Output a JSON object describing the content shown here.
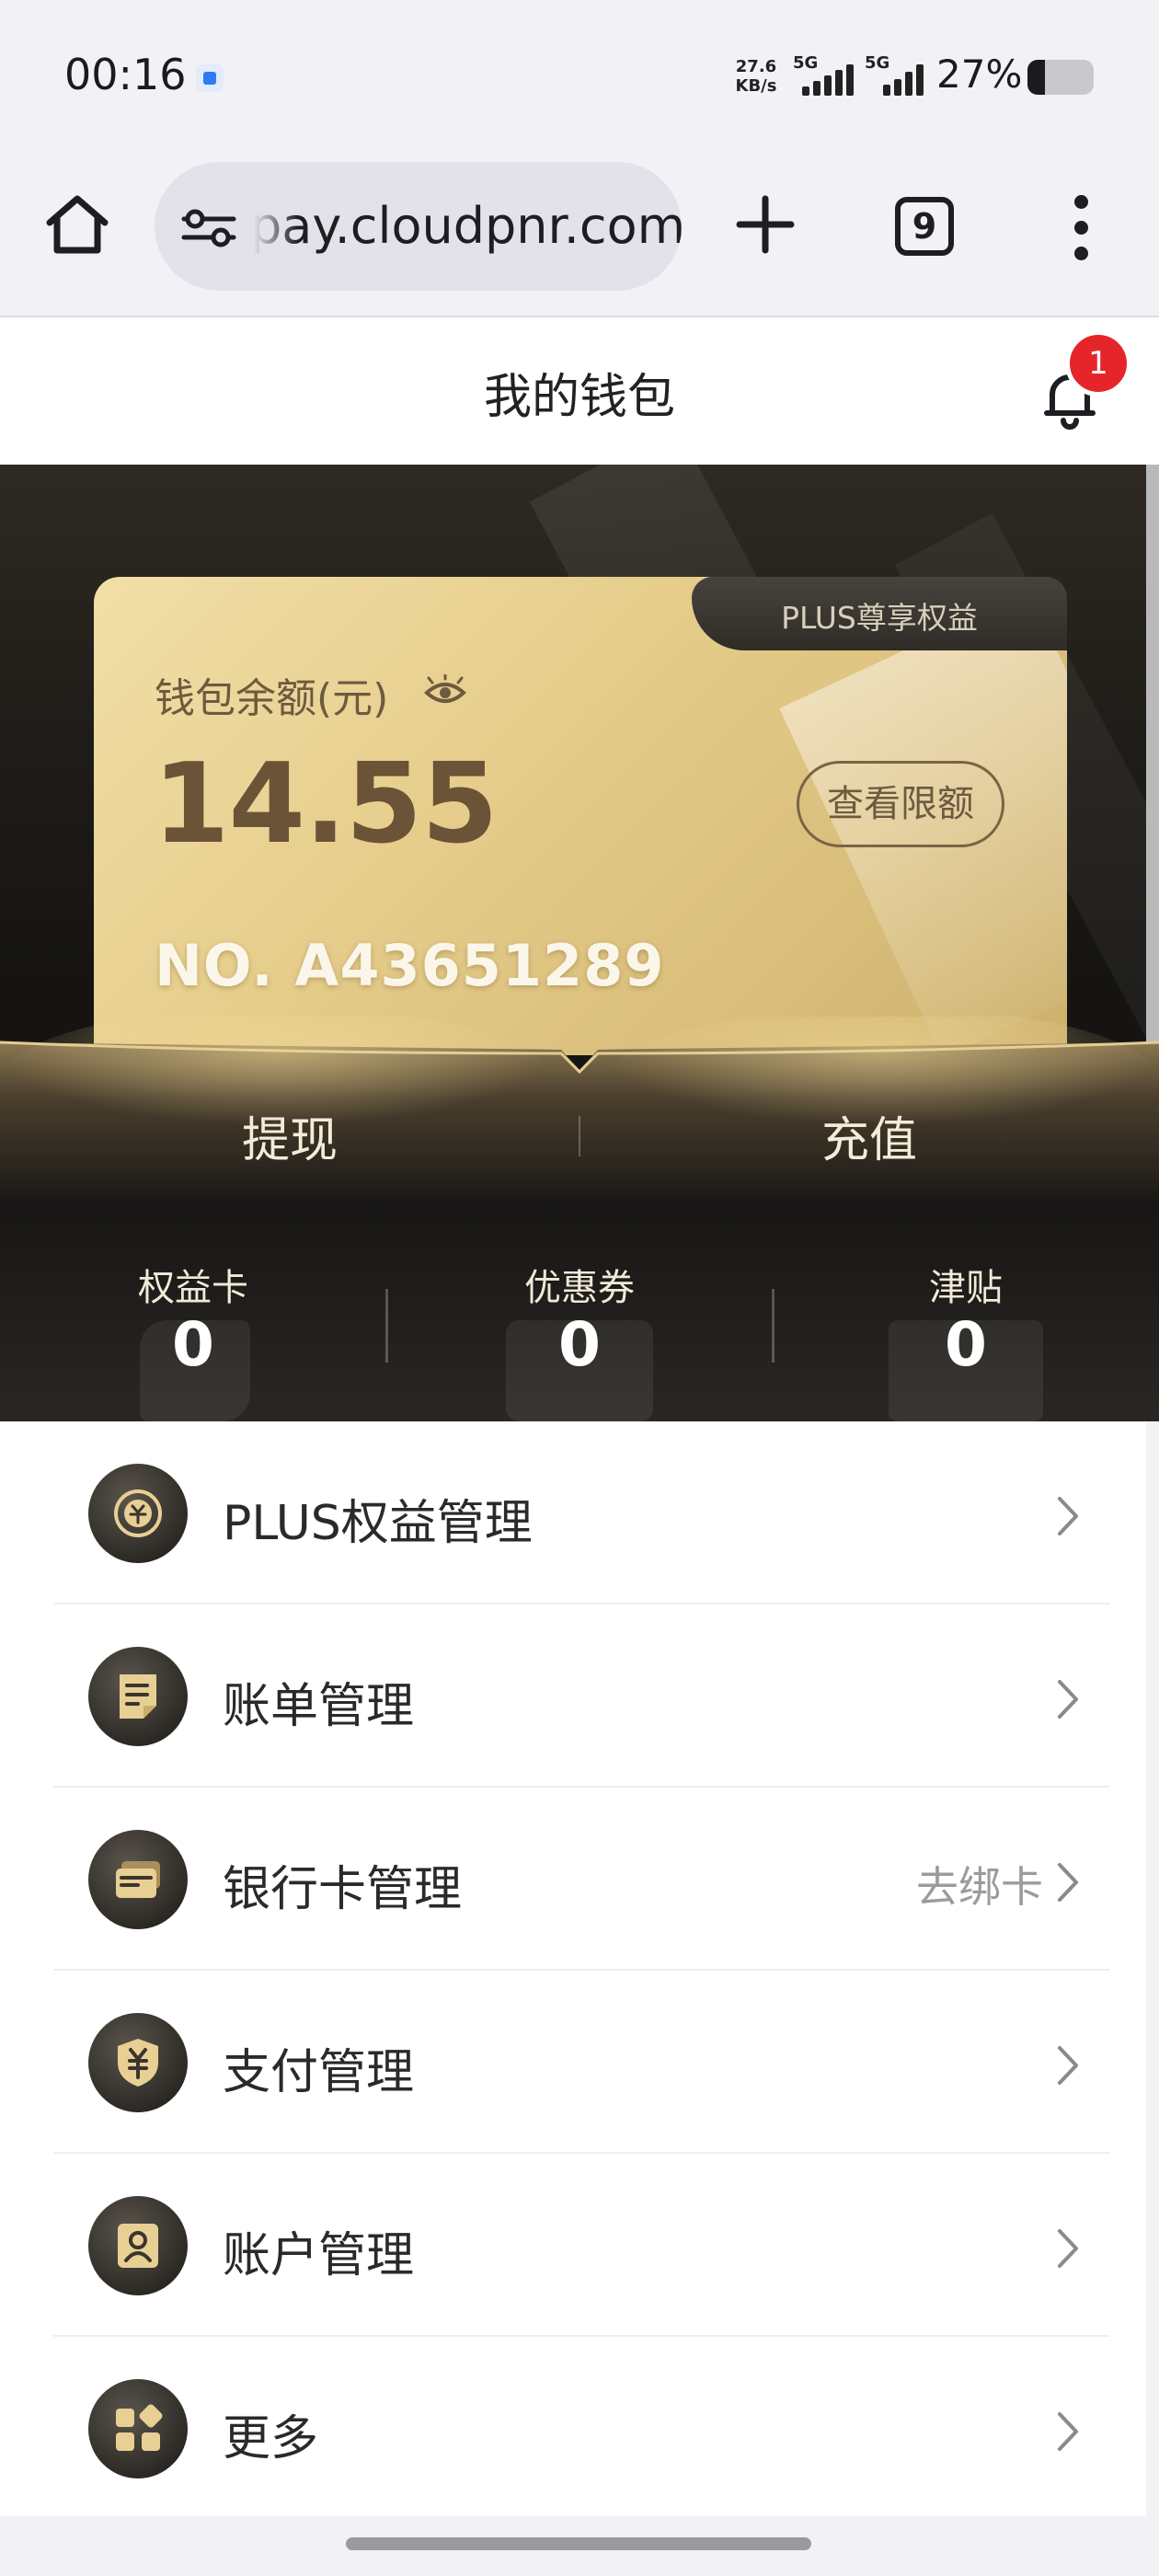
{
  "status_bar": {
    "time": "00:16",
    "net_speed_value": "27.6",
    "net_speed_unit": "KB/s",
    "sim1_label": "5G",
    "sim2_label": "5G",
    "battery_percent": "27%",
    "battery_level": 0.27
  },
  "browser": {
    "url": "pay.cloudpnr.com",
    "tab_count": "9"
  },
  "header": {
    "title": "我的钱包",
    "notification_count": "1"
  },
  "wallet": {
    "plus_tab_label": "PLUS尊享权益",
    "balance_label": "钱包余额(元)",
    "balance": "14.55",
    "view_limit_label": "查看限额",
    "card_number": "NO. A43651289",
    "withdraw_label": "提现",
    "recharge_label": "充值"
  },
  "stats": [
    {
      "label": "权益卡",
      "value": "0"
    },
    {
      "label": "优惠券",
      "value": "0"
    },
    {
      "label": "津贴",
      "value": "0"
    }
  ],
  "menu": [
    {
      "label": "PLUS权益管理",
      "extra": "",
      "icon": "plus-benefit-icon"
    },
    {
      "label": "账单管理",
      "extra": "",
      "icon": "bill-icon"
    },
    {
      "label": "银行卡管理",
      "extra": "去绑卡",
      "icon": "bank-card-icon"
    },
    {
      "label": "支付管理",
      "extra": "",
      "icon": "payment-shield-icon"
    },
    {
      "label": "账户管理",
      "extra": "",
      "icon": "account-icon"
    },
    {
      "label": "更多",
      "extra": "",
      "icon": "more-apps-icon"
    }
  ],
  "colors": {
    "gold_card": "#e6cd8b",
    "dark_bg": "#1e1c18",
    "badge_red": "#e5252a",
    "icon_gold": "#e8cf94"
  }
}
